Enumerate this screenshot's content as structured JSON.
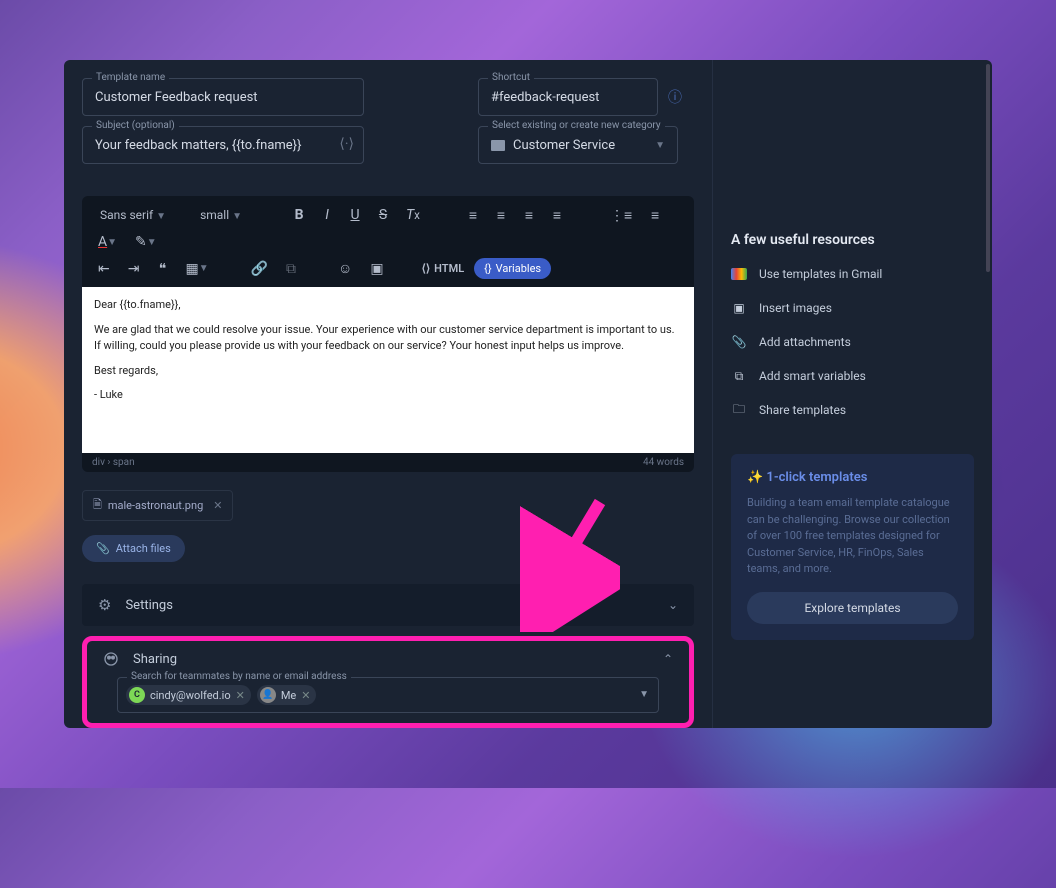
{
  "form": {
    "template_name_label": "Template name",
    "template_name_value": "Customer Feedback request",
    "shortcut_label": "Shortcut",
    "shortcut_value": "#feedback-request",
    "subject_label": "Subject (optional)",
    "subject_value": "Your feedback matters, {{to.fname}}",
    "category_label": "Select existing or create new category",
    "category_value": "Customer Service"
  },
  "toolbar": {
    "font": "Sans serif",
    "size": "small",
    "html": "HTML",
    "variables": "Variables"
  },
  "editor": {
    "greeting": "Dear {{to.fname}},",
    "body": "We are glad that we could resolve your issue. Your experience with our customer service department is important to us. If willing, could you please provide us with your feedback on our service? Your honest input helps us improve.",
    "closing": "Best regards,",
    "signature": "- Luke"
  },
  "status": {
    "path": "div › span",
    "words": "44 words"
  },
  "attachment": {
    "filename": "male-astronaut.png",
    "attach_btn": "Attach files"
  },
  "sections": {
    "settings": "Settings",
    "sharing": "Sharing",
    "sharing_search_label": "Search for teammates by name or email address",
    "chips": [
      {
        "initial": "C",
        "label": "cindy@wolfed.io"
      },
      {
        "initial": "",
        "label": "Me"
      }
    ]
  },
  "resources": {
    "title": "A few useful resources",
    "items": [
      "Use templates in Gmail",
      "Insert images",
      "Add attachments",
      "Add smart variables",
      "Share templates"
    ]
  },
  "promo": {
    "title": "✨ 1-click templates",
    "text": "Building a team email template catalogue can be challenging. Browse our collection of over 100 free templates designed for Customer Service, HR, FinOps, Sales teams, and more.",
    "btn": "Explore templates"
  }
}
